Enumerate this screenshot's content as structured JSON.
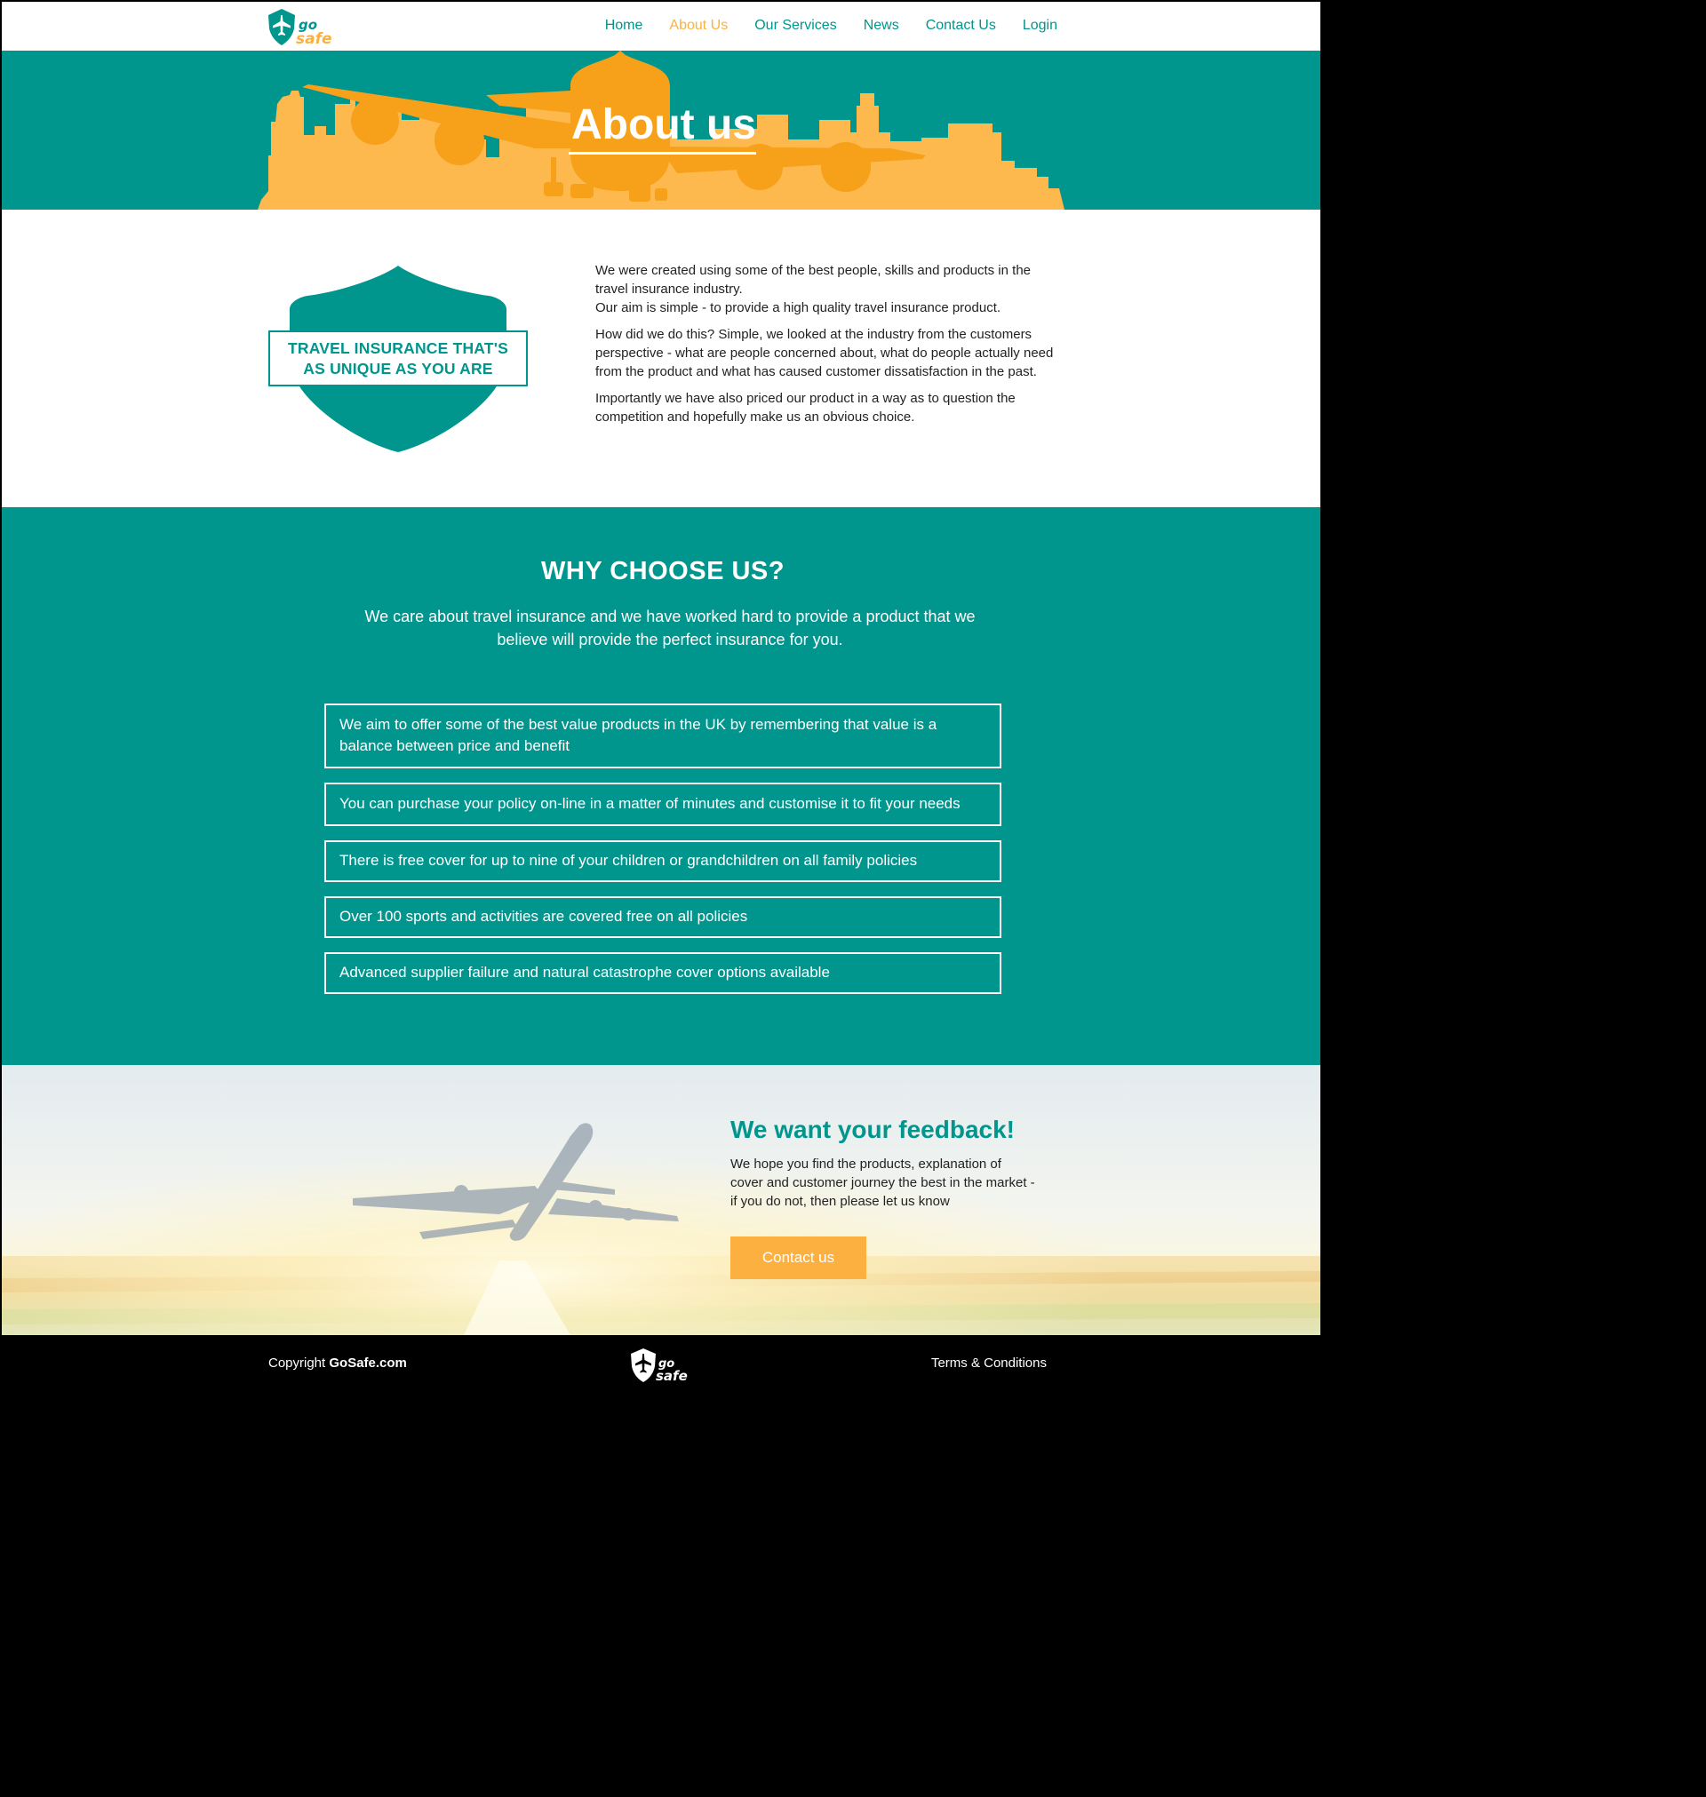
{
  "brand": {
    "logo_word_top": "go",
    "logo_word_bottom": "safe",
    "colors": {
      "teal": "#00958d",
      "orange": "#fbb040",
      "white": "#ffffff",
      "black": "#000000"
    }
  },
  "nav": {
    "items": [
      {
        "label": "Home",
        "active": false
      },
      {
        "label": "About Us",
        "active": true
      },
      {
        "label": "Our Services",
        "active": false
      },
      {
        "label": "News",
        "active": false
      },
      {
        "label": "Contact Us",
        "active": false
      },
      {
        "label": "Login",
        "active": false
      }
    ]
  },
  "hero": {
    "title": "About us"
  },
  "intro": {
    "badge_line1": "TRAVEL INSURANCE THAT'S",
    "badge_line2": "AS UNIQUE AS YOU ARE",
    "para1_line1": "We were created using some of the best people, skills and products in the travel insurance industry.",
    "para1_line2": "Our aim is simple - to provide a high quality travel insurance product.",
    "para2": "How did we do this? Simple, we looked at the industry from the customers perspective - what are people concerned about, what do people actually need from the product and what has caused customer dissatisfaction in the past.",
    "para3": "Importantly we have also priced our product in a way as to question the competition and hopefully make us an obvious choice."
  },
  "why": {
    "title": "WHY CHOOSE US?",
    "subtitle": "We care about travel insurance and we have worked hard to provide a product that we believe will provide the perfect insurance for you.",
    "items": [
      "We aim to offer some of the best value products in the UK by remembering that value is a balance between price and benefit",
      "You can purchase your policy on-line in a matter of minutes and customise it to fit your needs",
      "There is free cover for up to nine of your children or grandchildren on all family policies",
      "Over 100 sports and activities are covered free on all policies",
      "Advanced supplier failure and natural catastrophe cover options available"
    ]
  },
  "feedback": {
    "title": "We want your feedback!",
    "text": "We hope you find the products, explanation of cover and customer journey the best in the market - if you do not, then please let us know",
    "button_label": "Contact us"
  },
  "footer": {
    "copyright_prefix": "Copyright ",
    "copyright_brand": "GoSafe.com",
    "terms_label": "Terms & Conditions"
  },
  "icons": [
    "gosafe-logo-icon",
    "airplane-icon",
    "shield-icon"
  ]
}
